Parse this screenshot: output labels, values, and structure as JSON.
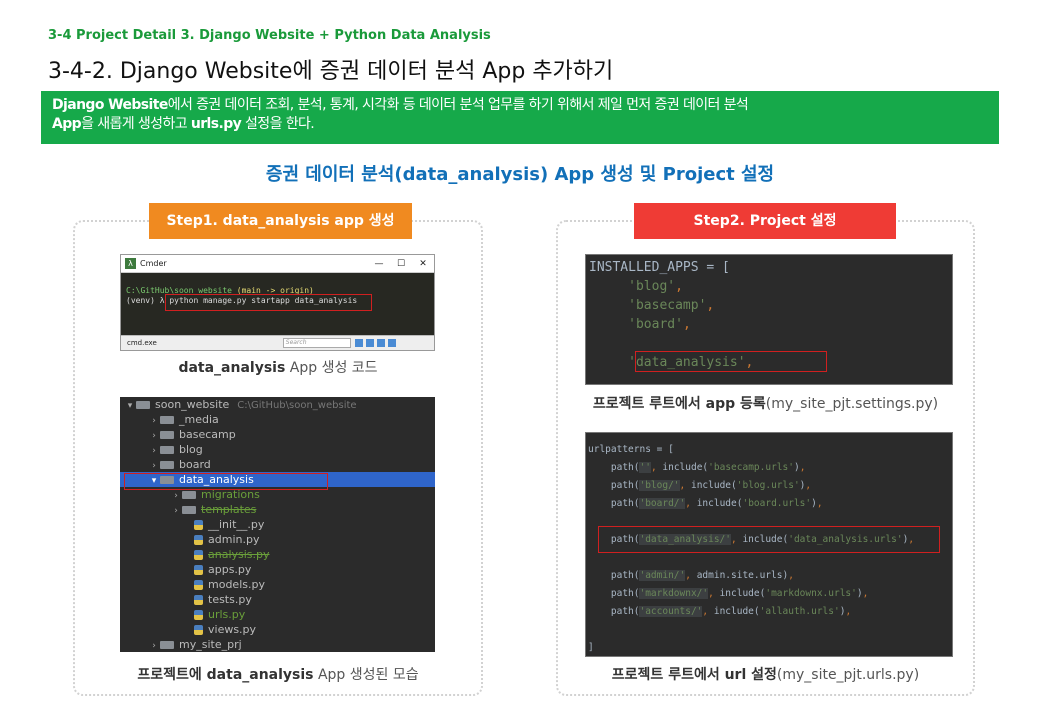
{
  "header": {
    "breadcrumb": "3-4 Project Detail 3. Django Website + Python Data Analysis",
    "title": "3-4-2. Django Website에 증권 데이터 분석 App 추가하기"
  },
  "banner": {
    "line1_bold": "Django Website",
    "line1_rest": "에서 증권 데이터 조회, 분석, 통계, 시각화 등 데이터 분석 업무를 하기 위해서 제일 먼저 증권 데이터 분석",
    "line2_bold_a": "App",
    "line2_mid": "을 새롭게 생성하고 ",
    "line2_bold_b": "urls.py",
    "line2_rest": " 설정을 한다."
  },
  "section_title": "증권 데이터 분석(data_analysis) App 생성 및 Project 설정",
  "step1": {
    "label": "Step1. data_analysis app 생성",
    "cmder": {
      "window_title": "Cmder",
      "path_line_a": "C:\\GitHub\\soon_website",
      "path_line_b": " (main -> origin)",
      "cmd_prefix": "(venv) λ ",
      "cmd": "python manage.py startapp data_analysis",
      "tab": "cmd.exe",
      "search_placeholder": "Search",
      "minimize": "—",
      "maximize": "☐",
      "close": "✕"
    },
    "caption1_bold": "data_analysis",
    "caption1_rest": " App 생성 코드",
    "tree": {
      "root": "soon_website",
      "root_path": "C:\\GitHub\\soon_website",
      "items": [
        "_media",
        "basecamp",
        "blog",
        "board",
        "data_analysis"
      ],
      "sub_dirs": [
        "migrations",
        "templates"
      ],
      "files": [
        "__init__.py",
        "admin.py",
        "analysis.py",
        "apps.py",
        "models.py",
        "tests.py",
        "urls.py",
        "views.py"
      ],
      "last": "my_site_prj"
    },
    "caption2_a": "프로젝트에 ",
    "caption2_bold": "data_analysis",
    "caption2_rest": " App 생성된 모습"
  },
  "step2": {
    "label": "Step2. Project  설정",
    "apps_code": {
      "line1": "INSTALLED_APPS = [",
      "items": [
        "'blog'",
        "'basecamp'",
        "'board'"
      ],
      "highlight": "'data_analysis'"
    },
    "caption1_bold": "프로젝트 루트에서 app 등록",
    "caption1_rest": "(my_site_pjt.settings.py)",
    "urls_code": {
      "head": "urlpatterns = [",
      "lines": [
        [
          "''",
          "'basecamp.urls'"
        ],
        [
          "'blog/'",
          "'blog.urls'"
        ],
        [
          "'board/'",
          "'board.urls'"
        ]
      ],
      "highlight_path": "'data_analysis/'",
      "highlight_include": "'data_analysis.urls'",
      "admin_path": "'admin/'",
      "admin_target": "admin.site.urls",
      "md_path": "'markdownx/'",
      "md_target": "'markdownx.urls'",
      "acc_path": "'accounts/'",
      "acc_target": "'allauth.urls'",
      "close": "]"
    },
    "caption2_bold": "프로젝트 루트에서 url 설정",
    "caption2_rest": "(my_site_pjt.urls.py)"
  }
}
